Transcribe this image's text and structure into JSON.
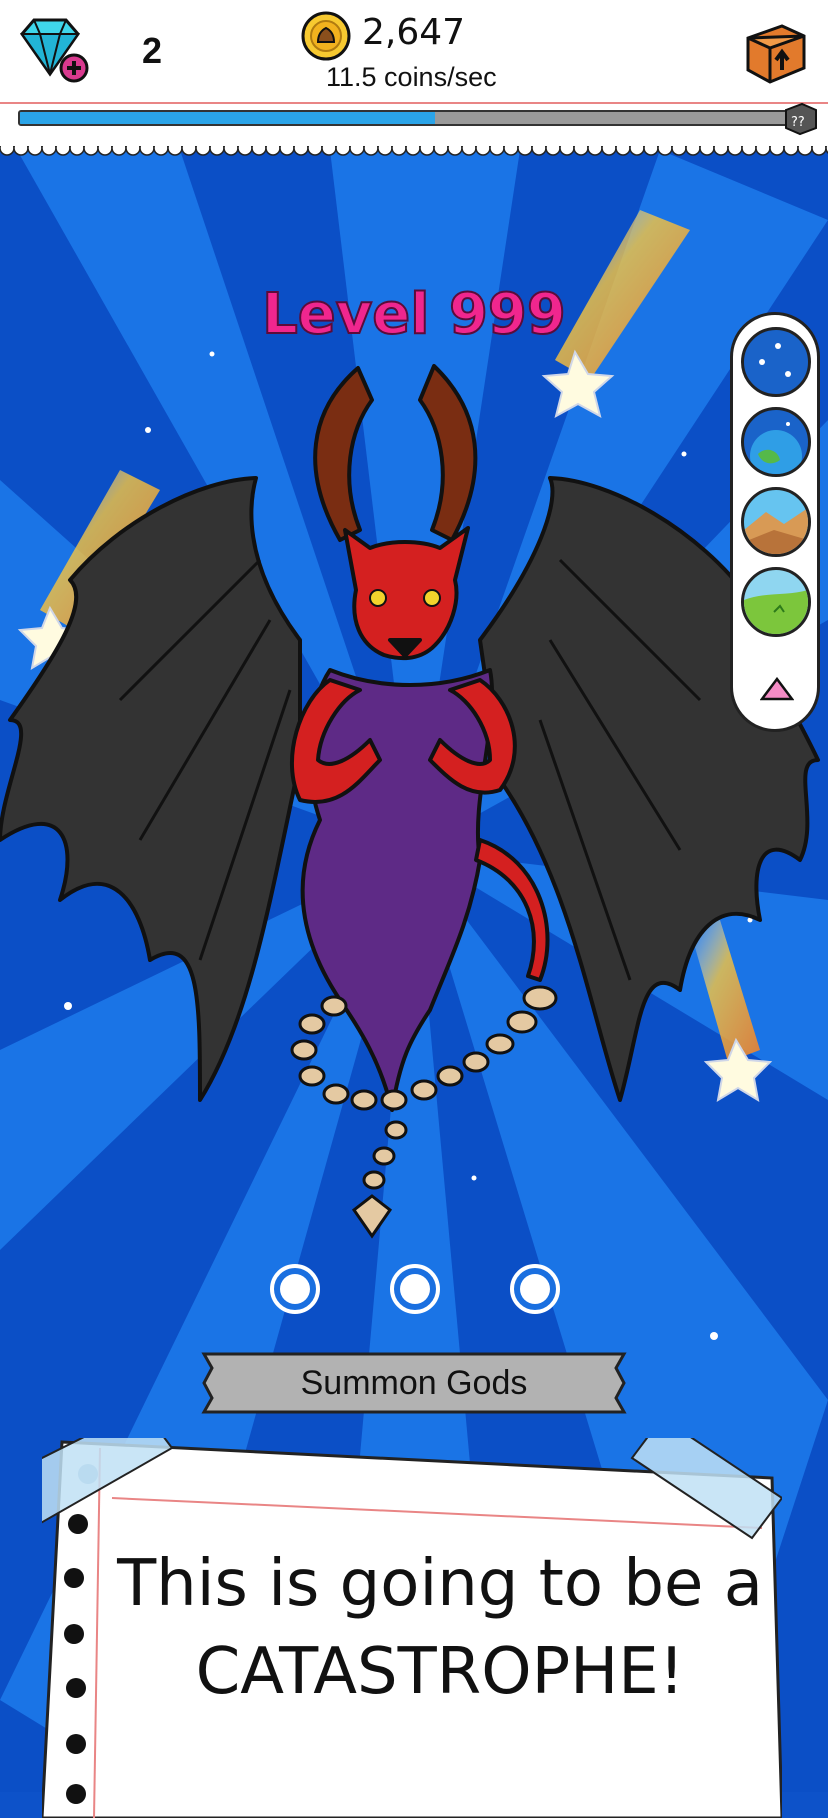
{
  "header": {
    "gem_count": "2",
    "coin_total": "2,647",
    "coin_rate": "11.5 coins/sec",
    "progress": 0.54
  },
  "stage": {
    "level_title": "Level 999"
  },
  "era_selector": {
    "items": [
      "space-era-icon",
      "planet-era-icon",
      "desert-era-icon",
      "grassland-era-icon"
    ]
  },
  "summon": {
    "label": "Summon Gods"
  },
  "note": {
    "line1": "This is going to be a",
    "line2": "CATASTROPHE!"
  },
  "colors": {
    "background": "#0d52c9",
    "level_text": "#f0268e",
    "progress_fill": "#2aa4e8"
  }
}
